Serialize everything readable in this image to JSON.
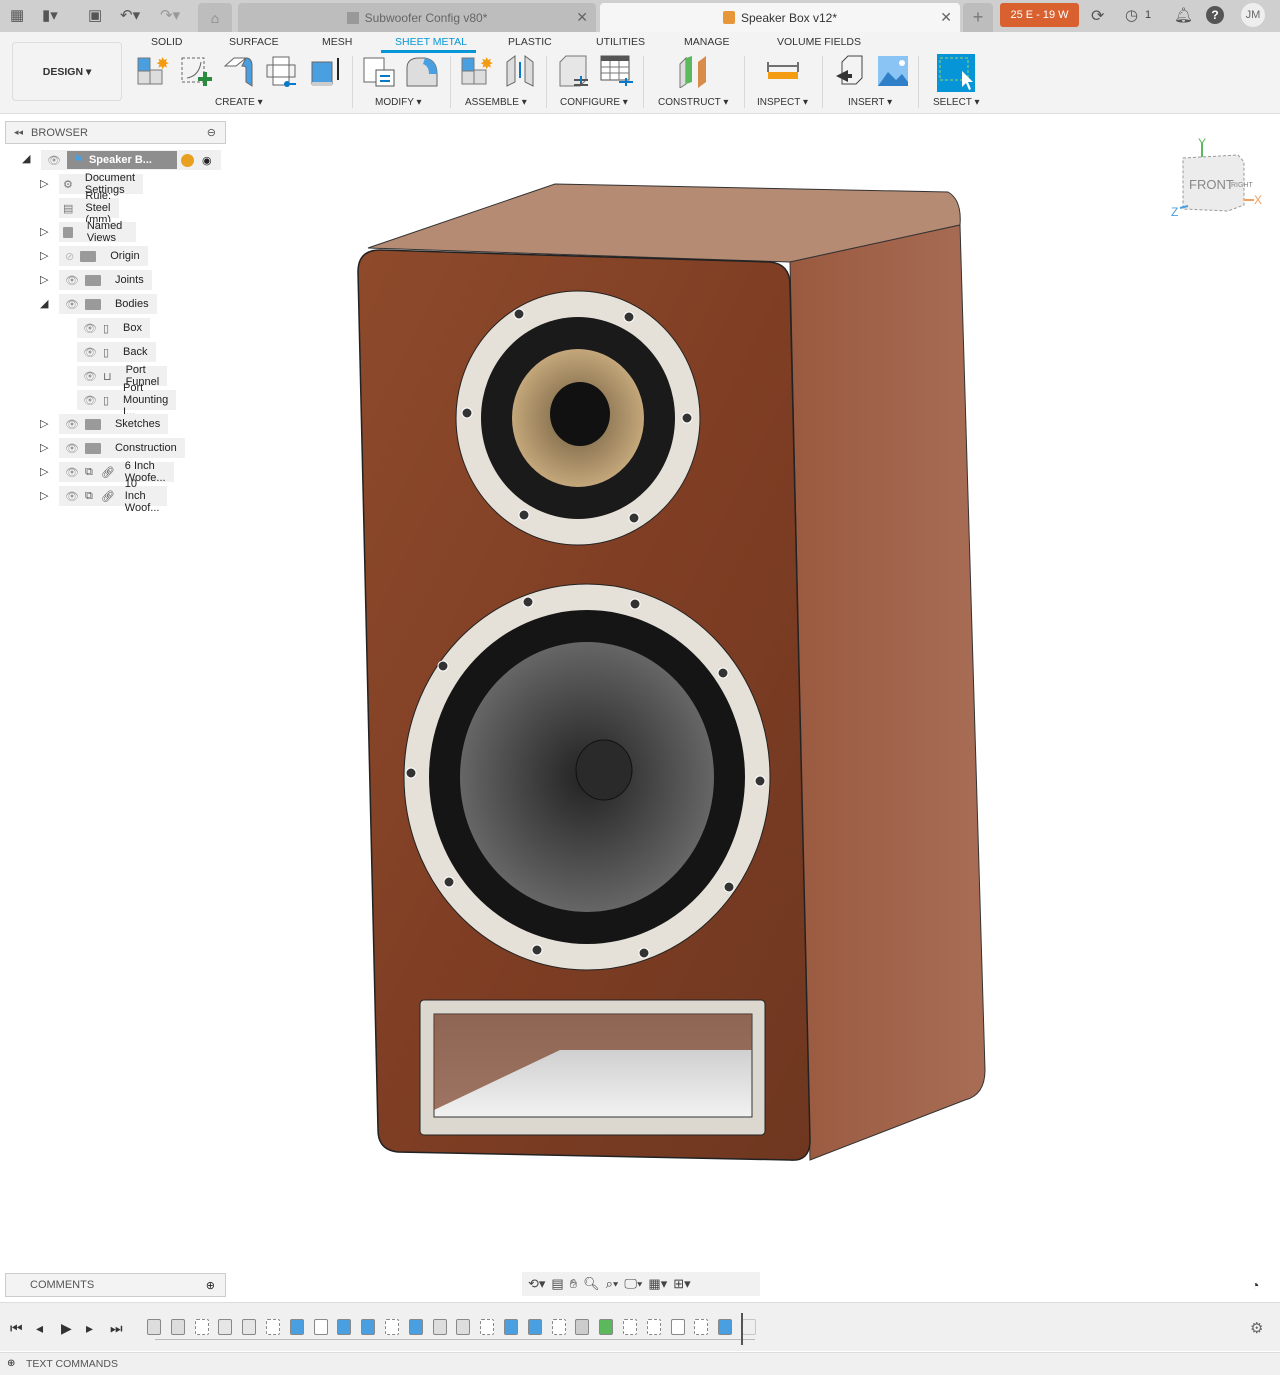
{
  "topbar": {
    "icons": [
      "apps-grid-icon",
      "file-icon",
      "save-icon",
      "undo-icon",
      "redo-icon",
      "home-icon"
    ],
    "tabs": [
      {
        "label": "Subwoofer Config v80*",
        "active": false
      },
      {
        "label": "Speaker Box v12*",
        "active": true
      }
    ],
    "badge": "25 E - 19 W",
    "badge_color": "#d9602f",
    "job_count": "1",
    "avatar": "JM"
  },
  "toolbar": {
    "workspace": "DESIGN",
    "tabs": [
      "SOLID",
      "SURFACE",
      "MESH",
      "SHEET METAL",
      "PLASTIC",
      "UTILITIES",
      "MANAGE",
      "VOLUME FIELDS"
    ],
    "active_tab": "SHEET METAL",
    "groups": [
      "CREATE",
      "MODIFY",
      "ASSEMBLE",
      "CONFIGURE",
      "CONSTRUCT",
      "INSPECT",
      "INSERT",
      "SELECT"
    ]
  },
  "browser": {
    "title": "BROWSER",
    "root": "Speaker B...",
    "items": [
      "Document Settings",
      "Rule: Steel (mm)",
      "Named Views",
      "Origin",
      "Joints",
      "Bodies",
      "Box",
      "Back",
      "Port Funnel",
      "Port Mounting I...",
      "Sketches",
      "Construction",
      "6 Inch Woofe...",
      "10 Inch Woof..."
    ]
  },
  "viewcube": {
    "face": "FRONT",
    "side": "RIGHT",
    "axes": [
      "Y",
      "X",
      "Z"
    ]
  },
  "comments": "COMMENTS",
  "text_commands": "TEXT COMMANDS",
  "timeline": {
    "items": [
      "joint",
      "joint",
      "sketch",
      "rigid",
      "rigid",
      "sketch",
      "extrude",
      "box",
      "extrude",
      "extrude",
      "sketch",
      "extrude",
      "fillet",
      "fillet",
      "sketch",
      "extrude",
      "extrude",
      "sketch",
      "shell",
      "plane",
      "sketch",
      "sketch",
      "flange",
      "sketch",
      "extrude",
      "ghost"
    ]
  }
}
